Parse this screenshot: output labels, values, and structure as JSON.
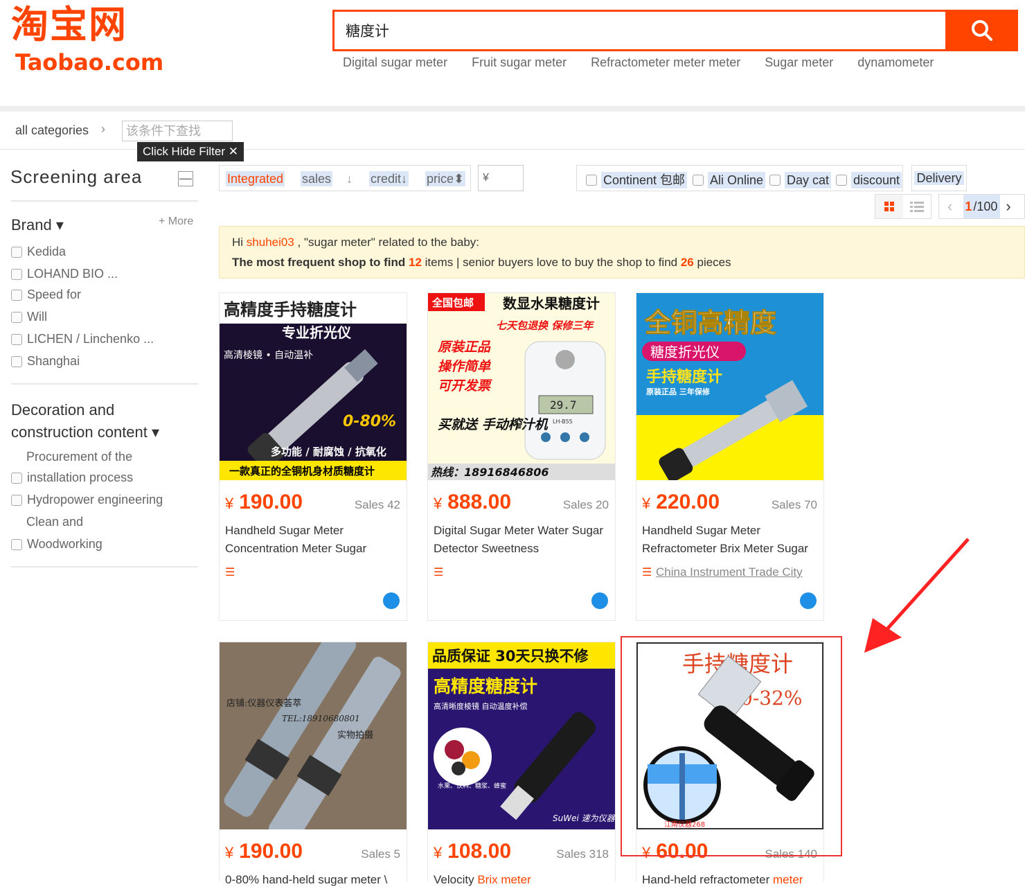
{
  "logo": {
    "cn": "淘宝网",
    "en": "Taobao.com"
  },
  "search": {
    "value": "糖度计"
  },
  "hotwords": [
    "Digital sugar meter",
    "Fruit sugar meter",
    "Refractometer meter meter",
    "Sugar meter",
    "dynamometer"
  ],
  "crumb": {
    "all": "all categories",
    "chev": "›",
    "filter_placeholder": "该条件下查找"
  },
  "tooltip": "Click Hide Filter ✕",
  "sidebar": {
    "title": "Screening area",
    "collapse": "—",
    "brand": "Brand ▾",
    "more": "+ More",
    "brands": [
      "Kedida",
      "LOHAND BIO ...",
      "Speed for",
      "Will",
      "LICHEN / Linchenko ...",
      "Shanghai"
    ],
    "deco_title_1": "Decoration and",
    "deco_title_2": "construction content ▾",
    "deco_items": [
      "Procurement of the",
      "installation process",
      "Hydropower engineering",
      "Clean and",
      "Woodworking"
    ]
  },
  "sort": {
    "integrated": "Integrated",
    "sales": "sales",
    "sales_arrow": "↓",
    "credit": "credit↓",
    "price": "price⬍",
    "price_from": "¥"
  },
  "filters": [
    "Continent 包邮",
    "Ali Online",
    "Day cat",
    "discount"
  ],
  "delivery": "Delivery",
  "pager": {
    "prev": "‹",
    "current": "1",
    "total": "/100",
    "next": "›"
  },
  "banner": {
    "hi": "Hi",
    "user": "shuhei03",
    "line1_rest": ", \"sugar meter\" related to the baby:",
    "l2_a": "The most frequent shop to find",
    "l2_n1": "12",
    "l2_b": "items | senior buyers love to buy the shop to find",
    "l2_n2": "26",
    "l2_c": "pieces"
  },
  "products": [
    {
      "price": "190.00",
      "sales": "Sales 42",
      "title": "Handheld Sugar Meter Concentration Meter Sugar",
      "img_title": "高精度手持糖度计",
      "img_sub": "专业折光仪",
      "img_note": "高清棱镜 • 自动温补",
      "img_range": "0-80%",
      "img_feat": "多功能 / 耐腐蚀 / 抗氧化",
      "img_bottom": "一款真正的全铜机身材质糖度计"
    },
    {
      "price": "888.00",
      "sales": "Sales 20",
      "title": "Digital Sugar Meter Water Sugar Detector Sweetness",
      "img_tag": "全国包邮",
      "img_title": "数显水果糖度计",
      "img_sub": "七天包退换 保修三年",
      "img_l1": "原装正品",
      "img_l2": "操作简单",
      "img_l3": "可开发票",
      "img_gift": "买就送 手动榨汁机",
      "img_hotline": "热线：18916846806",
      "img_display": "29.7",
      "img_model": "LH-B55"
    },
    {
      "price": "220.00",
      "sales": "Sales 70",
      "title": "Handheld Sugar Meter Refractometer Brix Meter Sugar",
      "shop": "China Instrument Trade City",
      "img_title": "全铜高精度",
      "img_sub": "糖度折光仪",
      "img_l3": "手持糖度计",
      "img_note": "原装正品 三年保修"
    },
    {
      "price": "190.00",
      "sales": "Sales 5",
      "title": "0-80% hand-held sugar meter \\",
      "img_wm": "店铺:仪器仪表荟萃",
      "img_tel": "TEL:18910680801",
      "img_real": "实物拍摄"
    },
    {
      "price": "108.00",
      "sales": "Sales 318",
      "title": "Velocity Brix meter",
      "title_hl": "Brix meter",
      "img_top": "品质保证 30天只换不修",
      "img_title": "高精度糖度计",
      "img_note": "高清晰度棱镜 自动温度补偿",
      "img_brand": "SuWei 速为仪器",
      "img_fruit": "水果、饮料、糖浆、蜂蜜"
    },
    {
      "price": "60.00",
      "sales": "Sales 140",
      "title": "Hand-held refractometer meter",
      "title_hl": "meter",
      "img_title": "手持糖度计",
      "img_range": "0-32%",
      "img_shop": "江南仪器268"
    }
  ],
  "yen": "¥",
  "colors": {
    "accent": "#ff4400",
    "highlight": "#dbe7f7",
    "banner_bg": "#fff7d9",
    "wangwang": "#1e8fe6"
  }
}
